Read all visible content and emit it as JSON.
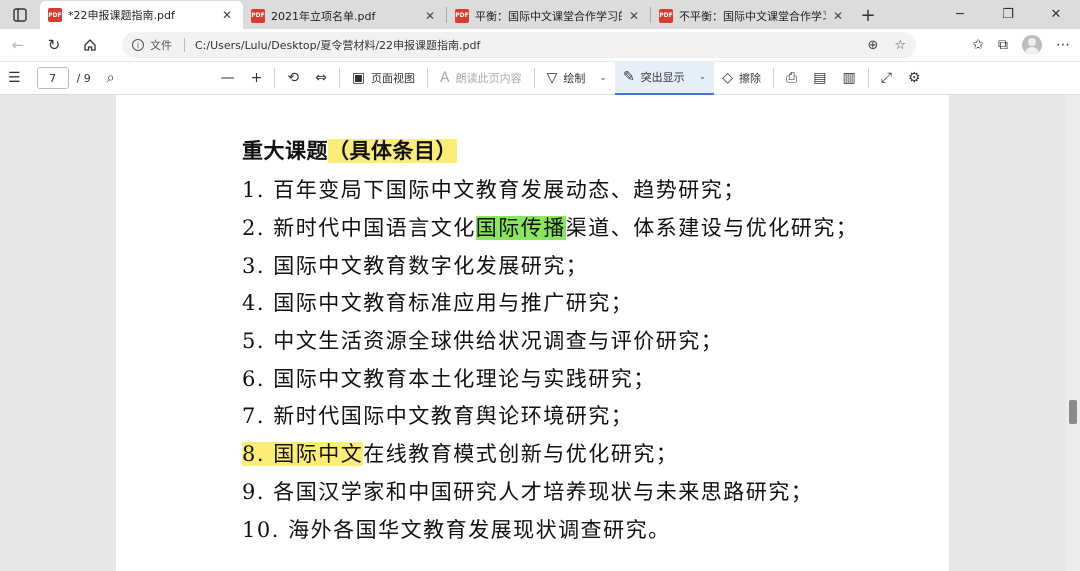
{
  "tabs": [
    {
      "title": "*22申报课题指南.pdf",
      "active": true
    },
    {
      "title": "2021年立项名单.pdf",
      "active": false
    },
    {
      "title": "平衡：国际中文课堂合作学习的",
      "active": false
    },
    {
      "title": "不平衡：国际中文课堂合作学习",
      "active": false
    }
  ],
  "tab_icon_text": "PDF",
  "address": {
    "scheme_label": "文件",
    "url": "C:/Users/Lulu/Desktop/夏令营材料/22申报课题指南.pdf"
  },
  "pdf_toolbar": {
    "current_page": "7",
    "total_pages": "/ 9",
    "page_view_label": "页面视图",
    "read_aloud_label": "朗读此页内容",
    "draw_label": "绘制",
    "highlight_label": "突出显示",
    "erase_label": "擦除"
  },
  "document": {
    "heading_plain": "重大课题",
    "heading_highlight": "（具体条目）",
    "items": [
      {
        "pre": "1. 百年变局下国际中文教育发展动态、趋势研究；",
        "hl": "",
        "post": ""
      },
      {
        "pre": "2. 新时代中国语言文化",
        "hl": "国际传播",
        "post": "渠道、体系建设与优化研究；",
        "hl_color": "green"
      },
      {
        "pre": "3. 国际中文教育数字化发展研究；",
        "hl": "",
        "post": ""
      },
      {
        "pre": "4. 国际中文教育标准应用与推广研究；",
        "hl": "",
        "post": ""
      },
      {
        "pre": "5. 中文生活资源全球供给状况调查与评价研究；",
        "hl": "",
        "post": ""
      },
      {
        "pre": "6. 国际中文教育本土化理论与实践研究；",
        "hl": "",
        "post": ""
      },
      {
        "pre": "7. 新时代国际中文教育舆论环境研究；",
        "hl": "",
        "post": ""
      },
      {
        "pre": "",
        "hl": "8. 国际中文",
        "post": "在线教育模式创新与优化研究；",
        "hl_color": "yellow"
      },
      {
        "pre": "9. 各国汉学家和中国研究人才培养现状与未来思路研究；",
        "hl": "",
        "post": ""
      },
      {
        "pre": "10. 海外各国华文教育发展现状调查研究。",
        "hl": "",
        "post": ""
      }
    ]
  },
  "colors": {
    "highlight_yellow": "#fbed75",
    "highlight_green": "#8ae65c",
    "pdf_icon": "#d83b2f"
  }
}
